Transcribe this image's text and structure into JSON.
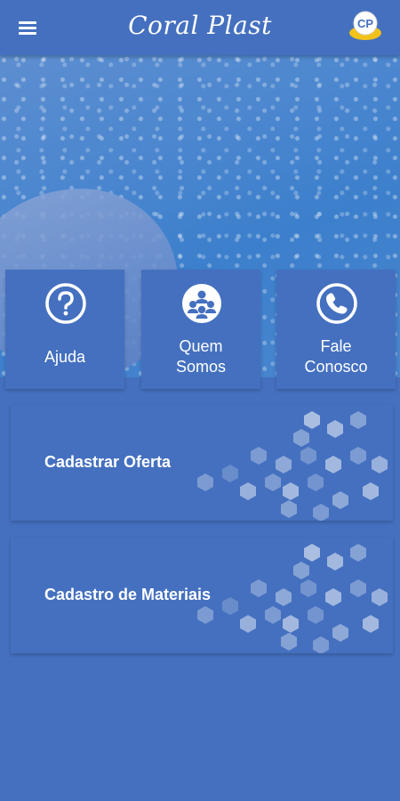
{
  "header": {
    "title": "Coral Plast",
    "logo_text": "CP",
    "menu_icon": "menu-icon"
  },
  "tiles": [
    {
      "label_lines": [
        "Ajuda"
      ],
      "icon": "help-icon"
    },
    {
      "label_lines": [
        "Quem",
        "Somos"
      ],
      "icon": "people-icon"
    },
    {
      "label_lines": [
        "Fale",
        "Conosco"
      ],
      "icon": "phone-icon"
    }
  ],
  "panels": [
    {
      "label": "Cadastrar Oferta"
    },
    {
      "label": "Cadastro de Materiais"
    }
  ],
  "colors": {
    "primary": "#4470bf",
    "logo_accent": "#f2c21a",
    "text": "#ffffff"
  }
}
